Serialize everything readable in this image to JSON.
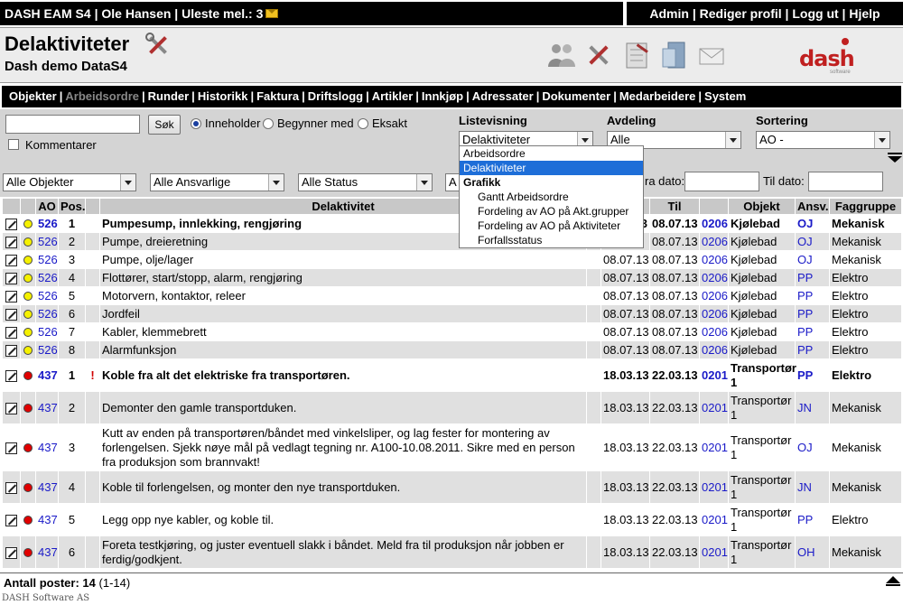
{
  "topbar": {
    "left": "DASH EAM S4 | Ole Hansen | Uleste mel.: 3",
    "right": [
      {
        "label": "Admin"
      },
      {
        "label": "Rediger profil"
      },
      {
        "label": "Logg ut"
      },
      {
        "label": "Hjelp"
      }
    ]
  },
  "header": {
    "title": "Delaktiviteter",
    "subtitle": "Dash demo DataS4",
    "icons": [
      "users-icon",
      "tools-icon",
      "checklist-icon",
      "server-icon",
      "mail-icon"
    ],
    "logo": {
      "word": "dash",
      "sub": "software"
    }
  },
  "nav": [
    {
      "label": "Objekter"
    },
    {
      "label": "Arbeidsordre",
      "active": true
    },
    {
      "label": "Runder"
    },
    {
      "label": "Historikk"
    },
    {
      "label": "Faktura"
    },
    {
      "label": "Driftslogg"
    },
    {
      "label": "Artikler"
    },
    {
      "label": "Innkjøp"
    },
    {
      "label": "Adressater"
    },
    {
      "label": "Dokumenter"
    },
    {
      "label": "Medarbeidere"
    },
    {
      "label": "System"
    }
  ],
  "filter": {
    "search_value": "",
    "search_button": "Søk",
    "radios": [
      {
        "label": "Inneholder",
        "checked": true
      },
      {
        "label": "Begynner med",
        "checked": false
      },
      {
        "label": "Eksakt",
        "checked": false
      }
    ],
    "kommentarer_label": "Kommentarer",
    "listevisning_label": "Listevisning",
    "listevisning_value": "Delaktiviteter",
    "avdeling_label": "Avdeling",
    "avdeling_value": "Alle",
    "sortering_label": "Sortering",
    "sortering_value": "AO -",
    "objekter_value": "Alle Objekter",
    "ansvarlige_value": "Alle Ansvarlige",
    "status_value": "Alle Status",
    "fourth_value": "A",
    "fra_dato_label": "ra dato:",
    "til_dato_label": "Til dato:"
  },
  "dropdown": [
    {
      "label": "Arbeidsordre",
      "kind": "item"
    },
    {
      "label": "Delaktiviteter",
      "kind": "selected"
    },
    {
      "label": "Grafikk",
      "kind": "group"
    },
    {
      "label": "Gantt Arbeidsordre",
      "kind": "sub"
    },
    {
      "label": "Fordeling av AO på Akt.grupper",
      "kind": "sub"
    },
    {
      "label": "Fordeling av AO på Aktiviteter",
      "kind": "sub"
    },
    {
      "label": "Forfallsstatus",
      "kind": "sub"
    }
  ],
  "table": {
    "headers": [
      "",
      "",
      "AO",
      "Pos.",
      "",
      "Delaktivitet",
      "",
      "",
      "Til",
      "",
      "Objekt",
      "Ansv.",
      "Faggruppe"
    ],
    "rows": [
      {
        "status": "yellow",
        "ao": "526",
        "pos": "1",
        "flag": "",
        "desc": "Pumpesump, innlekking, rengjøring",
        "from": "3",
        "to": "08.07.13",
        "obj_no": "0206",
        "obj": "Kjølebad",
        "ansv": "OJ",
        "fag": "Mekanisk",
        "bold": true,
        "h": 20
      },
      {
        "status": "yellow",
        "ao": "526",
        "pos": "2",
        "flag": "",
        "desc": "Pumpe, dreieretning",
        "from": "",
        "to": "08.07.13",
        "obj_no": "0206",
        "obj": "Kjølebad",
        "ansv": "OJ",
        "fag": "Mekanisk",
        "bold": false,
        "h": 20
      },
      {
        "status": "yellow",
        "ao": "526",
        "pos": "3",
        "flag": "",
        "desc": "Pumpe, olje/lager",
        "from": "08.07.13",
        "to": "08.07.13",
        "obj_no": "0206",
        "obj": "Kjølebad",
        "ansv": "OJ",
        "fag": "Mekanisk",
        "bold": false,
        "h": 20
      },
      {
        "status": "yellow",
        "ao": "526",
        "pos": "4",
        "flag": "",
        "desc": "Flottører, start/stopp, alarm, rengjøring",
        "from": "08.07.13",
        "to": "08.07.13",
        "obj_no": "0206",
        "obj": "Kjølebad",
        "ansv": "PP",
        "fag": "Elektro",
        "bold": false,
        "h": 20
      },
      {
        "status": "yellow",
        "ao": "526",
        "pos": "5",
        "flag": "",
        "desc": "Motorvern, kontaktor, releer",
        "from": "08.07.13",
        "to": "08.07.13",
        "obj_no": "0206",
        "obj": "Kjølebad",
        "ansv": "PP",
        "fag": "Elektro",
        "bold": false,
        "h": 20
      },
      {
        "status": "yellow",
        "ao": "526",
        "pos": "6",
        "flag": "",
        "desc": "Jordfeil",
        "from": "08.07.13",
        "to": "08.07.13",
        "obj_no": "0206",
        "obj": "Kjølebad",
        "ansv": "PP",
        "fag": "Elektro",
        "bold": false,
        "h": 20
      },
      {
        "status": "yellow",
        "ao": "526",
        "pos": "7",
        "flag": "",
        "desc": "Kabler, klemmebrett",
        "from": "08.07.13",
        "to": "08.07.13",
        "obj_no": "0206",
        "obj": "Kjølebad",
        "ansv": "PP",
        "fag": "Elektro",
        "bold": false,
        "h": 20
      },
      {
        "status": "yellow",
        "ao": "526",
        "pos": "8",
        "flag": "",
        "desc": "Alarmfunksjon",
        "from": "08.07.13",
        "to": "08.07.13",
        "obj_no": "0206",
        "obj": "Kjølebad",
        "ansv": "PP",
        "fag": "Elektro",
        "bold": false,
        "h": 20
      },
      {
        "status": "red",
        "ao": "437",
        "pos": "1",
        "flag": "!",
        "desc": "Koble fra alt det elektriske fra transportøren.",
        "from": "18.03.13",
        "to": "22.03.13",
        "obj_no": "0201",
        "obj": "Transportør 1",
        "ansv": "PP",
        "fag": "Elektro",
        "bold": true,
        "h": 36
      },
      {
        "status": "red",
        "ao": "437",
        "pos": "2",
        "flag": "",
        "desc": "Demonter den gamle transportduken.",
        "from": "18.03.13",
        "to": "22.03.13",
        "obj_no": "0201",
        "obj": "Transportør 1",
        "ansv": "JN",
        "fag": "Mekanisk",
        "bold": false,
        "h": 36
      },
      {
        "status": "red",
        "ao": "437",
        "pos": "3",
        "flag": "",
        "desc": "Kutt av enden på transportøren/båndet med vinkelsliper, og lag fester for montering av forlengelsen. Sjekk nøye mål på vedlagt tegning nr. A100-10.08.2011. Sikre med en person fra produksjon som brannvakt!",
        "from": "18.03.13",
        "to": "22.03.13",
        "obj_no": "0201",
        "obj": "Transportør 1",
        "ansv": "OJ",
        "fag": "Mekanisk",
        "bold": false,
        "h": 52
      },
      {
        "status": "red",
        "ao": "437",
        "pos": "4",
        "flag": "",
        "desc": "Koble til forlengelsen, og monter den nye transportduken.",
        "from": "18.03.13",
        "to": "22.03.13",
        "obj_no": "0201",
        "obj": "Transportør 1",
        "ansv": "JN",
        "fag": "Mekanisk",
        "bold": false,
        "h": 36
      },
      {
        "status": "red",
        "ao": "437",
        "pos": "5",
        "flag": "",
        "desc": "Legg opp nye kabler, og koble til.",
        "from": "18.03.13",
        "to": "22.03.13",
        "obj_no": "0201",
        "obj": "Transportør 1",
        "ansv": "PP",
        "fag": "Elektro",
        "bold": false,
        "h": 36
      },
      {
        "status": "red",
        "ao": "437",
        "pos": "6",
        "flag": "",
        "desc": "Foreta testkjøring, og juster eventuell slakk i båndet. Meld fra til produksjon når jobben er ferdig/godkjent.",
        "from": "18.03.13",
        "to": "22.03.13",
        "obj_no": "0201",
        "obj": "Transportør 1",
        "ansv": "OH",
        "fag": "Mekanisk",
        "bold": false,
        "h": 36
      }
    ]
  },
  "footer": {
    "label": "Antall poster:",
    "count": "14",
    "range": "(1-14)"
  },
  "copyright": "DASH Software AS"
}
